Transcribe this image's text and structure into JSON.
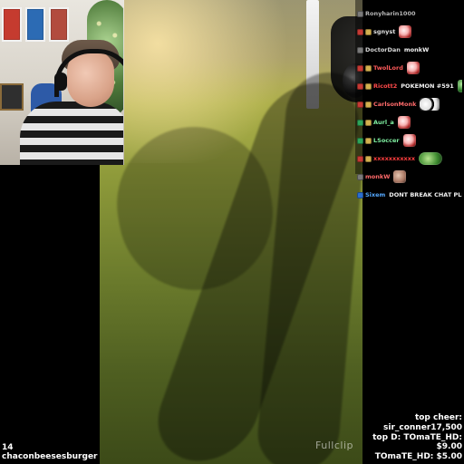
{
  "chat": {
    "messages": [
      {
        "user": "Ronyharin1000",
        "user_color": "#b7b7b7",
        "text": "",
        "emotes": [],
        "badges": [
          "gray"
        ]
      },
      {
        "user": "sgnyst",
        "user_color": "#e0e0e0",
        "text": "",
        "emotes": [
          "kappa"
        ],
        "badges": [
          "red",
          "gold"
        ]
      },
      {
        "user": "DoctorDan",
        "user_color": "#d8d8d8",
        "text": "monkW",
        "emotes": [],
        "badges": [
          "gray"
        ]
      },
      {
        "user": "TwolLord",
        "user_color": "#ff5a5a",
        "text": "",
        "emotes": [
          "kappa"
        ],
        "badges": [
          "red",
          "gold"
        ]
      },
      {
        "user": "Ricott2",
        "user_color": "#ff4a4a",
        "text": "POKEMON #591",
        "emotes": [
          "pepe"
        ],
        "badges": [
          "red",
          "gold"
        ]
      },
      {
        "user": "CarlsonMonk",
        "user_color": "#ff6a6a",
        "text": "",
        "emotes": [
          "eye"
        ],
        "badges": [
          "red",
          "gold"
        ]
      },
      {
        "user": "Aurl_a",
        "user_color": "#7ff0a1",
        "text": "",
        "emotes": [
          "kappa"
        ],
        "badges": [
          "green",
          "gold"
        ]
      },
      {
        "user": "LSoccer",
        "user_color": "#7ff0a1",
        "text": "",
        "emotes": [
          "kappa"
        ],
        "badges": [
          "green",
          "gold"
        ]
      },
      {
        "user": "xxxxxxxxxxx",
        "user_color": "#ff3f3f",
        "text": "",
        "emotes": [
          "pickle"
        ],
        "badges": [
          "red",
          "gold"
        ]
      },
      {
        "user": "monkW",
        "user_color": "#ff6a6a",
        "text": "",
        "emotes": [
          "face"
        ],
        "badges": [
          "gray"
        ]
      },
      {
        "user": "Sixem",
        "user_color": "#54a8ff",
        "text": "DONT BREAK CHAT PLEASE",
        "emotes": [],
        "badges": [
          "blue"
        ]
      }
    ]
  },
  "event": {
    "count": "14",
    "name": "chaconbeesesburger"
  },
  "leaderboard": {
    "lines": [
      "top cheer: sir_conner17,500",
      "top D: TOmaTE_HD: $9.00",
      "TOmaTE_HD: $5.00"
    ]
  },
  "watermark": {
    "text": "Fullclip"
  }
}
